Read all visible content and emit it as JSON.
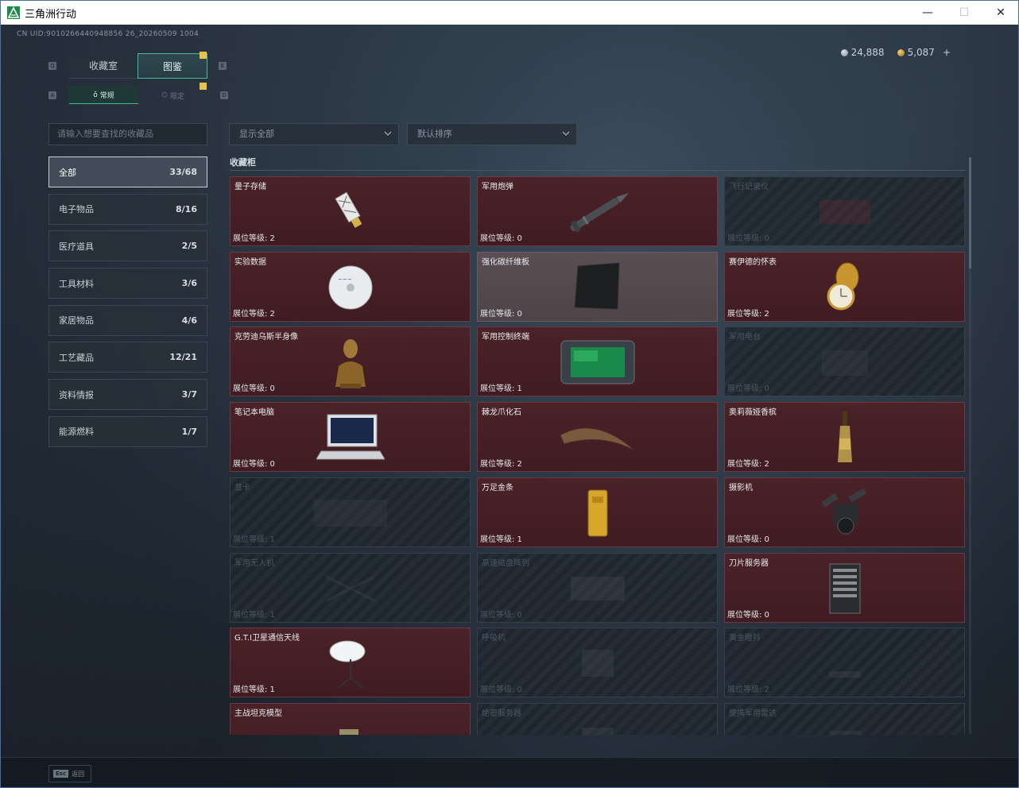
{
  "window": {
    "title": "三角洲行动",
    "minimize": "—",
    "maximize": "☐",
    "close": "✕"
  },
  "header": {
    "uid": "CN UID:9010266440948856 26_20260509 1004",
    "silver": "24,888",
    "gold": "5,087",
    "plus": "+"
  },
  "tabs": [
    {
      "label": "收藏室",
      "active": false
    },
    {
      "label": "图鉴",
      "active": true
    }
  ],
  "subtabs": [
    {
      "label": "常规",
      "active": true
    },
    {
      "label": "限定",
      "active": false
    }
  ],
  "hotkeys": {
    "q": "Q",
    "e": "E",
    "a": "A",
    "d": "D"
  },
  "search": {
    "placeholder": "请输入想要查找的收藏品"
  },
  "filters": {
    "show": "显示全部",
    "sort": "默认排序"
  },
  "categories": [
    {
      "label": "全部",
      "count": "33/68",
      "active": true
    },
    {
      "label": "电子物品",
      "count": "8/16"
    },
    {
      "label": "医疗道具",
      "count": "2/5"
    },
    {
      "label": "工具材料",
      "count": "3/6"
    },
    {
      "label": "家居物品",
      "count": "4/6"
    },
    {
      "label": "工艺藏品",
      "count": "12/21"
    },
    {
      "label": "资料情报",
      "count": "3/7"
    },
    {
      "label": "能源燃料",
      "count": "1/7"
    }
  ],
  "section": {
    "title": "收藏柜"
  },
  "items": [
    {
      "name": "量子存储",
      "level": "展位等级: 2",
      "state": "owned",
      "icon": "usb-drive-icon"
    },
    {
      "name": "军用炮弹",
      "level": "展位等级: 0",
      "state": "owned",
      "icon": "artillery-shell-icon"
    },
    {
      "name": "飞行记录仪",
      "level": "展位等级: 0",
      "state": "locked",
      "icon": "flight-recorder-icon"
    },
    {
      "name": "实验数据",
      "level": "展位等级: 2",
      "state": "owned",
      "icon": "disc-icon"
    },
    {
      "name": "强化碳纤维板",
      "level": "展位等级: 0",
      "state": "owned-grey",
      "icon": "carbon-plate-icon"
    },
    {
      "name": "赛伊德的怀表",
      "level": "展位等级: 2",
      "state": "owned",
      "icon": "pocket-watch-icon"
    },
    {
      "name": "克劳迪乌斯半身像",
      "level": "展位等级: 0",
      "state": "owned",
      "icon": "bust-icon"
    },
    {
      "name": "军用控制终端",
      "level": "展位等级: 1",
      "state": "owned",
      "icon": "control-terminal-icon"
    },
    {
      "name": "军用电台",
      "level": "展位等级: 0",
      "state": "locked",
      "icon": "radio-icon"
    },
    {
      "name": "笔记本电脑",
      "level": "展位等级: 0",
      "state": "owned",
      "icon": "laptop-icon"
    },
    {
      "name": "棘龙爪化石",
      "level": "展位等级: 2",
      "state": "owned",
      "icon": "claw-fossil-icon"
    },
    {
      "name": "奥莉薇娅香槟",
      "level": "展位等级: 2",
      "state": "owned",
      "icon": "champagne-icon"
    },
    {
      "name": "显卡",
      "level": "展位等级: 1",
      "state": "locked",
      "icon": "gpu-icon"
    },
    {
      "name": "万足金条",
      "level": "展位等级: 1",
      "state": "owned",
      "icon": "gold-bar-icon"
    },
    {
      "name": "摄影机",
      "level": "展位等级: 0",
      "state": "owned",
      "icon": "camera-icon"
    },
    {
      "name": "军用无人机",
      "level": "展位等级: 1",
      "state": "locked",
      "icon": "drone-icon"
    },
    {
      "name": "高速磁盘阵列",
      "level": "展位等级: 0",
      "state": "locked",
      "icon": "disk-array-icon"
    },
    {
      "name": "刀片服务器",
      "level": "展位等级: 0",
      "state": "owned",
      "icon": "server-icon"
    },
    {
      "name": "G.T.I卫星通信天线",
      "level": "展位等级: 1",
      "state": "owned",
      "icon": "satellite-dish-icon"
    },
    {
      "name": "呼吸机",
      "level": "展位等级: 0",
      "state": "locked",
      "icon": "ventilator-icon"
    },
    {
      "name": "黄金瞪羚",
      "level": "展位等级: 2",
      "state": "locked",
      "icon": "gazelle-icon"
    },
    {
      "name": "主战坦克模型",
      "level": "",
      "state": "owned",
      "icon": "tank-model-icon"
    },
    {
      "name": "绝密服务器",
      "level": "",
      "state": "locked",
      "icon": "secret-server-icon"
    },
    {
      "name": "便携军用雷达",
      "level": "",
      "state": "locked",
      "icon": "radar-icon"
    }
  ],
  "footer": {
    "esc_key": "Esc",
    "esc_label": "返回"
  }
}
